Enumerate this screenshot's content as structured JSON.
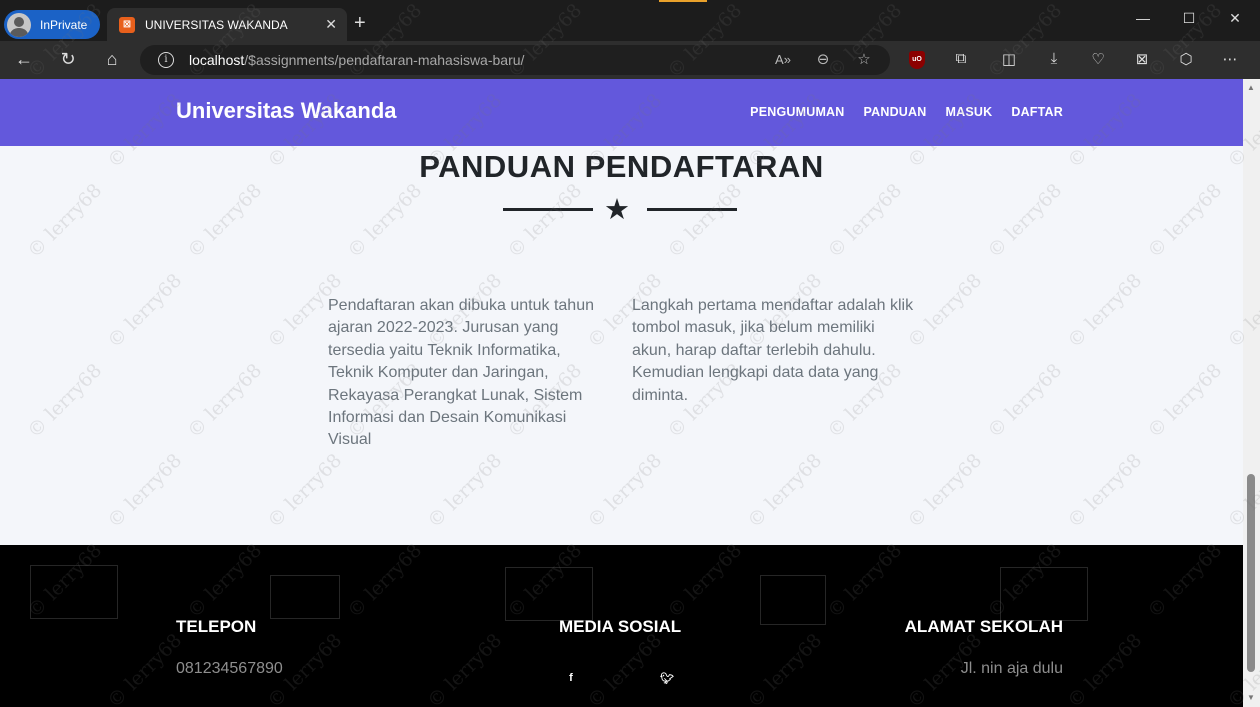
{
  "browser": {
    "inprivate_label": "InPrivate",
    "tab_title": "UNIVERSITAS WAKANDA",
    "tab_close": "✕",
    "new_tab": "+",
    "url_host": "localhost",
    "url_path": "/$assignments/pendaftaran-mahasiswa-baru/",
    "window_controls": [
      "—",
      "☐",
      "✕"
    ]
  },
  "navbar": {
    "brand": "Universitas Wakanda",
    "menu": [
      "PENGUMUMAN",
      "PANDUAN",
      "MASUK",
      "DAFTAR"
    ]
  },
  "section": {
    "title": "PANDUAN PENDAFTARAN",
    "divider_icon": "star-icon",
    "col1": "Pendaftaran akan dibuka untuk tahun ajaran 2022-2023. Jurusan yang tersedia yaitu Teknik Informatika, Teknik Komputer dan Jaringan, Rekayasa Perangkat Lunak, Sistem Informasi dan Desain Komunikasi Visual",
    "col2": "Langkah pertama mendaftar adalah klik tombol masuk, jika belum memiliki akun, harap daftar terlebih dahulu. Kemudian lengkapi data data yang diminta."
  },
  "footer": {
    "telepon_heading": "TELEPON",
    "telepon_value": "081234567890",
    "sosial_heading": "MEDIA SOSIAL",
    "social_icons": [
      "facebook-icon",
      "twitter-icon"
    ],
    "alamat_heading": "ALAMAT SEKOLAH",
    "alamat_value": "Jl. nin aja dulu"
  },
  "watermark_text": "© lerry68",
  "colors": {
    "navbar": "#6358dc",
    "page_bg": "#f4f6fa",
    "footer_bg": "#000000"
  }
}
